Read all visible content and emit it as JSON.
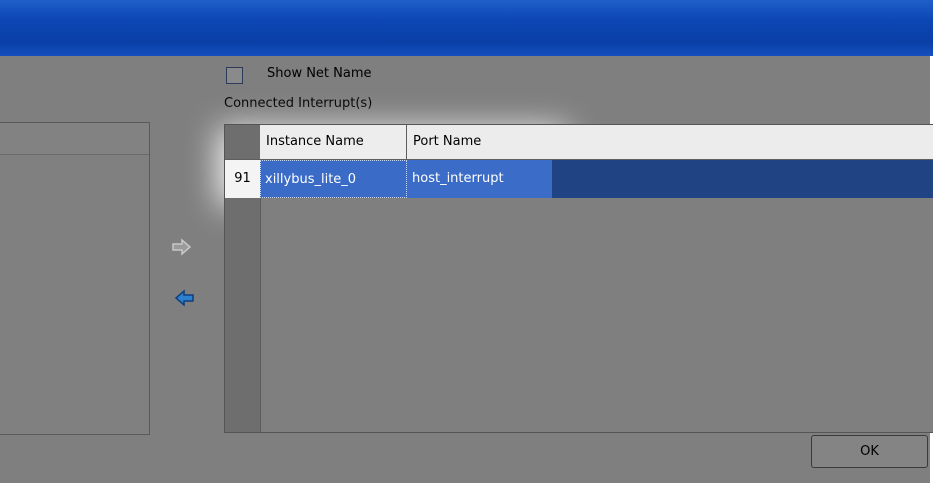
{
  "options": {
    "show_net_name_label": "Show Net Name",
    "show_net_name_checked": false
  },
  "connected": {
    "label": "Connected Interrupt(s)",
    "columns": [
      "Instance Name",
      "Port Name"
    ],
    "rows": [
      {
        "number": "91",
        "instance": "xillybus_lite_0",
        "port": "host_interrupt"
      }
    ]
  },
  "arrows": {
    "add_icon": "arrow-right-icon",
    "remove_icon": "arrow-left-icon"
  },
  "footer": {
    "ok_label": "OK"
  },
  "colors": {
    "title_bar": "#0d47b5",
    "selection": "#3b6cc8",
    "selection_dark": "#1f4383",
    "remove_arrow": "#2d7fd0"
  }
}
